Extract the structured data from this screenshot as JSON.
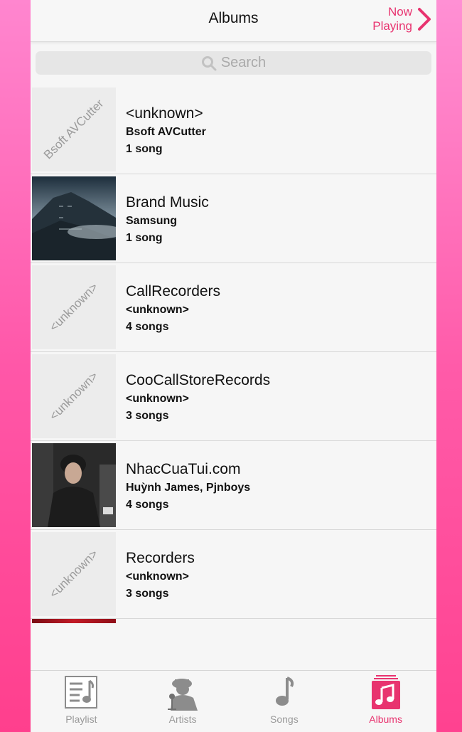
{
  "header": {
    "title": "Albums",
    "now_playing_line1": "Now",
    "now_playing_line2": "Playing"
  },
  "search": {
    "placeholder": "Search"
  },
  "albums": [
    {
      "name": "<unknown>",
      "artist": "Bsoft AVCutter",
      "count": "1 song",
      "art_placeholder": "Bsoft AVCutter",
      "art_type": "placeholder"
    },
    {
      "name": "Brand Music",
      "artist": "Samsung",
      "count": "1 song",
      "art_type": "image-mountain"
    },
    {
      "name": "CallRecorders",
      "artist": "<unknown>",
      "count": "4 songs",
      "art_placeholder": "<unknown>",
      "art_type": "placeholder"
    },
    {
      "name": "CooCallStoreRecords",
      "artist": "<unknown>",
      "count": "3 songs",
      "art_placeholder": "<unknown>",
      "art_type": "placeholder"
    },
    {
      "name": "NhacCuaTui.com",
      "artist": "Huỳnh James, Pjnboys",
      "count": "4 songs",
      "art_type": "image-person"
    },
    {
      "name": "Recorders",
      "artist": "<unknown>",
      "count": "3 songs",
      "art_placeholder": "<unknown>",
      "art_type": "placeholder"
    }
  ],
  "tabs": [
    {
      "label": "Playlist",
      "icon": "playlist-icon",
      "active": false
    },
    {
      "label": "Artists",
      "icon": "artists-icon",
      "active": false
    },
    {
      "label": "Songs",
      "icon": "music-note-icon",
      "active": false
    },
    {
      "label": "Albums",
      "icon": "albums-icon",
      "active": true
    }
  ],
  "colors": {
    "accent": "#e8336f",
    "inactive": "#9a9a9a",
    "background": "#f6f6f6"
  }
}
